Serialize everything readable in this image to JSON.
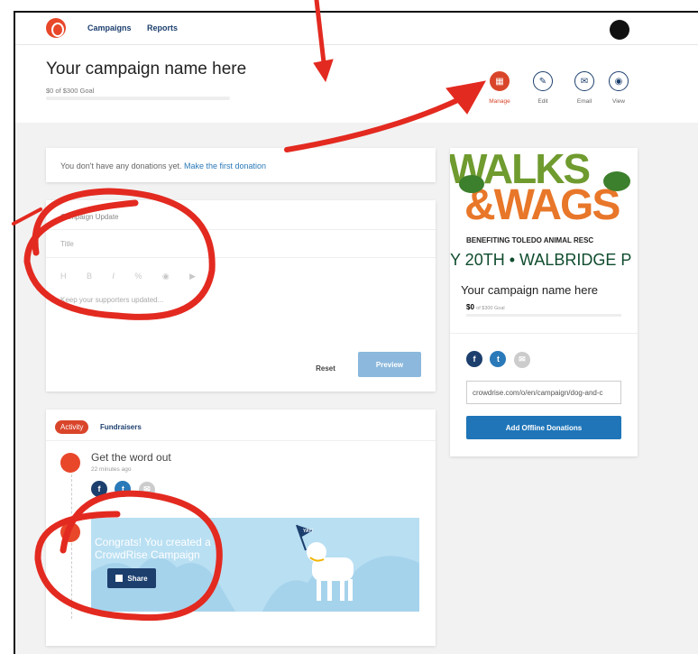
{
  "nav": {
    "links": [
      "Campaigns",
      "Reports"
    ]
  },
  "header": {
    "title": "Your campaign name here",
    "goal_text": "$0 of $300 Goal",
    "actions": [
      {
        "label": "Manage",
        "icon": "grid-icon",
        "active": true
      },
      {
        "label": "Edit",
        "icon": "pencil-icon",
        "active": false
      },
      {
        "label": "Email",
        "icon": "envelope-icon",
        "active": false
      },
      {
        "label": "View",
        "icon": "eye-icon",
        "active": false
      }
    ]
  },
  "donations": {
    "message": "You don't have any donations yet.",
    "link": "Make the first donation"
  },
  "update": {
    "heading": "Campaign Update",
    "title_placeholder": "Title",
    "toolbar": [
      "H",
      "B",
      "I",
      "%",
      "◉",
      "▶"
    ],
    "body_placeholder": "Keep your supporters updated...",
    "reset_label": "Reset",
    "preview_label": "Preview"
  },
  "activity": {
    "tabs": [
      "Activity",
      "Fundraisers"
    ],
    "item_title": "Get the word out",
    "item_time": "22 minutes ago",
    "banner_text": "Congrats! You created a CrowdRise Campaign",
    "banner_flag": "YAY!",
    "share_label": "Share"
  },
  "sidebar": {
    "image_line1": "WALKS",
    "image_line2": "&WAGS",
    "image_line3": "BENEFITING TOLEDO ANIMAL RESC",
    "image_line4": "Y 20TH • WALBRIDGE P",
    "title": "Your campaign name here",
    "amount": "$0",
    "goal_small": "of $300 Goal",
    "url": "crowdrise.com/o/en/campaign/dog-and-c",
    "offline_button": "Add Offline Donations",
    "social": [
      "f",
      "t",
      "✉"
    ]
  },
  "colors": {
    "brand": "#d9452a",
    "navy": "#1c3f6e",
    "button_blue": "#1f75b8",
    "preview_blue": "#8bb8dc",
    "annotation_red": "#e32a20"
  }
}
